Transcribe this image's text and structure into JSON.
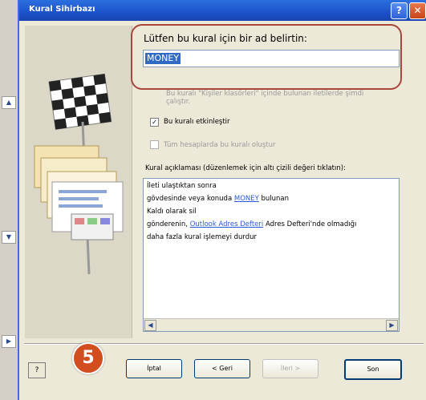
{
  "dialog": {
    "title": "Kural Sihirbazı",
    "help_button": "?",
    "close_button": "✕"
  },
  "form": {
    "name_prompt": "Lütfen bu kural için bir ad belirtin:",
    "name_value": "MONEY",
    "hidden_option_line1": "Bu kuralı \"Kişiler klasörleri\" içinde bulunan iletilerde şimdi",
    "hidden_option_line2": "çalıştır.",
    "enable_rule_label": "Bu kuralı etkinleştir",
    "enable_rule_checked": true,
    "apply_all_accounts_label": "Tüm hesaplarda bu kuralı oluştur",
    "apply_all_accounts_checked": false,
    "description_label": "Kural açıklaması (düzenlemek için altı çizili değeri tıklatın):"
  },
  "description": {
    "line1": "İleti ulaştıktan sonra",
    "line2_prefix": "gövdesinde veya konuda ",
    "line2_link": "MONEY",
    "line2_suffix": " bulunan",
    "line3": "Kaldı olarak sil",
    "line4_prefix": "gönderenin, ",
    "line4_link": "Outlook Adres Defteri",
    "line4_suffix": " Adres Defteri'nde olmadığı",
    "line5": "daha fazla kural işlemeyi durdur"
  },
  "buttons": {
    "cancel": "İptal",
    "back": "< Geri",
    "next": "İleri >",
    "finish": "Son"
  },
  "annotation": {
    "step_number": "5"
  },
  "background_strip": {
    "items": [
      "▲",
      "▼",
      "▶"
    ]
  }
}
